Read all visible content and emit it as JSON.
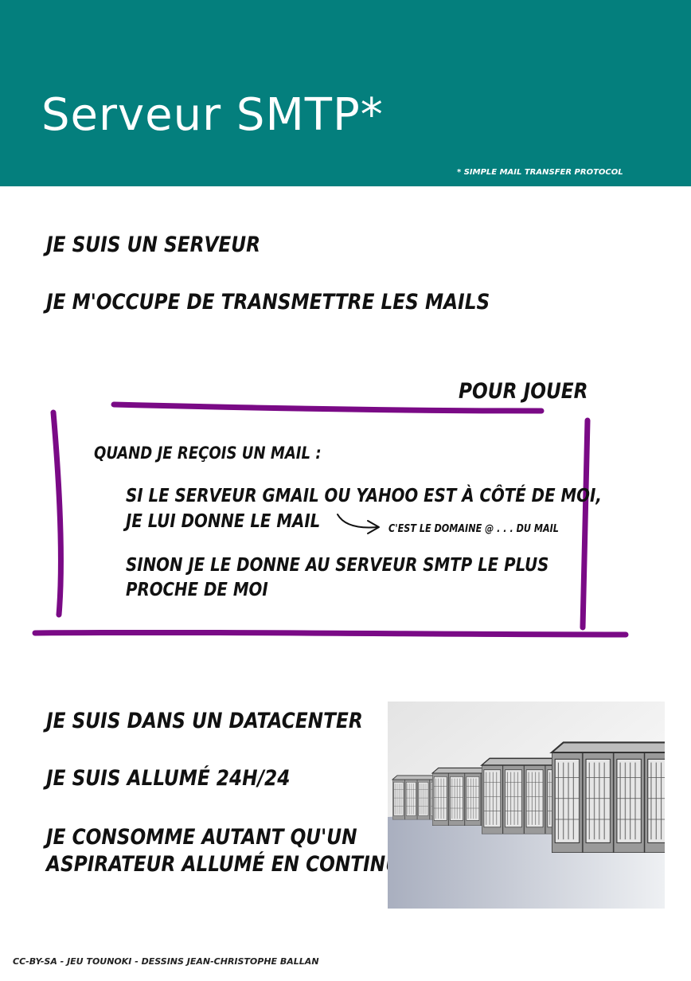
{
  "header": {
    "title": "Serveur SMTP*",
    "footnote": "* SIMPLE MAIL TRANSFER PROTOCOL",
    "background_color": "#047f7d"
  },
  "intro": {
    "line1": "JE SUIS UN SERVEUR",
    "line2": "JE M'OCCUPE DE TRANSMETTRE LES MAILS"
  },
  "play_box": {
    "label": "POUR JOUER",
    "frame_color": "#7a0a86",
    "when": "QUAND JE REÇOIS UN MAIL :",
    "rule1_line1": "SI LE SERVEUR GMAIL OU YAHOO EST À CÔTÉ DE MOI,",
    "rule1_line2": "JE LUI DONNE LE MAIL",
    "annotation": "C'EST LE DOMAINE @ . . . DU MAIL",
    "rule2_line1": "SINON JE LE DONNE AU SERVEUR SMTP LE PLUS",
    "rule2_line2": "PROCHE DE MOI"
  },
  "facts": {
    "line1": "JE SUIS DANS UN DATACENTER",
    "line2": "JE SUIS ALLUMÉ 24H/24",
    "line3": "JE CONSOMME AUTANT QU'UN",
    "line4": "ASPIRATEUR ALLUMÉ EN CONTINU."
  },
  "credits": "CC-BY-SA - JEU TOUNOKI - DESSINS JEAN-CHRISTOPHE BALLAN",
  "illustration": {
    "icon": "datacenter-server-racks-illustration"
  }
}
